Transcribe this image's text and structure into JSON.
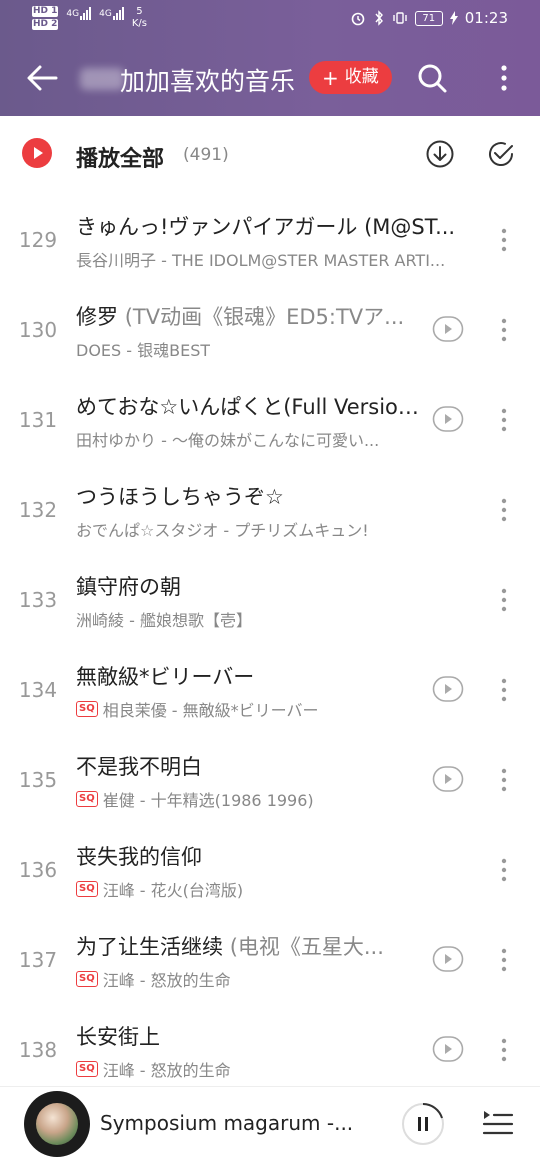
{
  "status_bar": {
    "hd1": "HD 1",
    "hd2": "HD 2",
    "net1": "4G",
    "net2": "4G",
    "speed_value": "5",
    "speed_unit": "K/s",
    "battery": "71",
    "time": "01:23"
  },
  "header": {
    "title": "加加喜欢的音乐",
    "collect_label": "收藏",
    "colors": {
      "gradient_start": "#6b5a8c",
      "gradient_end": "#7b5a99",
      "accent": "#ec3d40"
    }
  },
  "play_all": {
    "label": "播放全部",
    "count": "(491)"
  },
  "songs": [
    {
      "index": "129",
      "title": "きゅんっ!ヴァンパイアガール (M@ST...",
      "subtitle": "",
      "sq": false,
      "meta": "長谷川明子 - THE IDOLM@STER MASTER ARTI...",
      "has_mv": false
    },
    {
      "index": "130",
      "title": "修罗 ",
      "subtitle": "(TV动画《银魂》ED5:TVア...",
      "sq": false,
      "meta": "DOES - 银魂BEST",
      "has_mv": true
    },
    {
      "index": "131",
      "title": "めておな☆いんぱくと(Full Version.)",
      "subtitle": "",
      "sq": false,
      "meta": "田村ゆかり - ～俺の妹がこんなに可愛い...",
      "has_mv": true
    },
    {
      "index": "132",
      "title": "つうほうしちゃうぞ☆",
      "subtitle": "",
      "sq": false,
      "meta": "おでんぱ☆スタジオ - プチリズムキュン!",
      "has_mv": false
    },
    {
      "index": "133",
      "title": "鎮守府の朝",
      "subtitle": "",
      "sq": false,
      "meta": "洲崎綾 - 艦娘想歌【壱】",
      "has_mv": false
    },
    {
      "index": "134",
      "title": "無敵級*ビリーバー",
      "subtitle": "",
      "sq": true,
      "meta": "相良茉優 - 無敵級*ビリーバー",
      "has_mv": true
    },
    {
      "index": "135",
      "title": "不是我不明白",
      "subtitle": "",
      "sq": true,
      "meta": "崔健 - 十年精选(1986 1996)",
      "has_mv": true
    },
    {
      "index": "136",
      "title": "丧失我的信仰",
      "subtitle": "",
      "sq": true,
      "meta": "汪峰 - 花火(台湾版)",
      "has_mv": false
    },
    {
      "index": "137",
      "title": "为了让生活继续 ",
      "subtitle": "(电视《五星大...",
      "sq": true,
      "meta": "汪峰 - 怒放的生命",
      "has_mv": true
    },
    {
      "index": "138",
      "title": "长安街上",
      "subtitle": "",
      "sq": true,
      "meta": "汪峰 - 怒放的生命",
      "has_mv": true
    }
  ],
  "sq_badge": "SQ",
  "player": {
    "title": "Symposium magarum -..."
  }
}
